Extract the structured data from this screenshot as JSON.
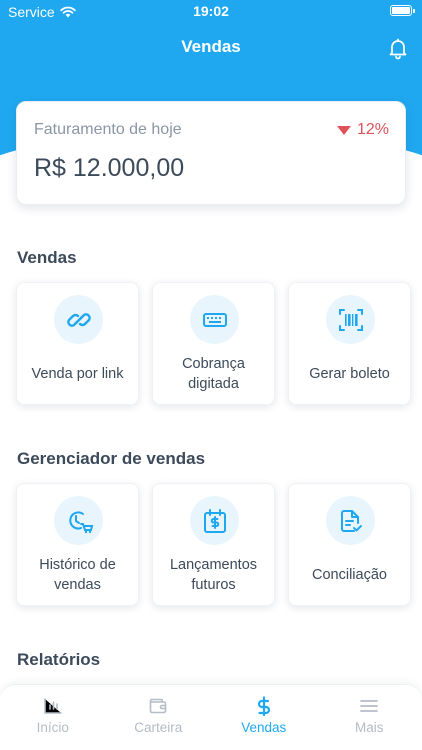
{
  "status_bar": {
    "carrier": "Service",
    "time": "19:02"
  },
  "header": {
    "title": "Vendas"
  },
  "revenue_card": {
    "label": "Faturamento de hoje",
    "change": "12%",
    "value": "R$ 12.000,00"
  },
  "sections": {
    "vendas": {
      "title": "Vendas",
      "tiles": [
        {
          "label": "Venda por link",
          "icon": "link-icon"
        },
        {
          "label": "Cobrança\ndigitada",
          "icon": "keyboard-icon"
        },
        {
          "label": "Gerar boleto",
          "icon": "barcode-icon"
        }
      ]
    },
    "gerenciador": {
      "title": "Gerenciador de vendas",
      "tiles": [
        {
          "label": "Histórico de\nvendas",
          "icon": "sales-history-icon"
        },
        {
          "label": "Lançamentos\nfuturos",
          "icon": "calendar-dollar-icon"
        },
        {
          "label": "Conciliação",
          "icon": "document-check-icon"
        }
      ]
    },
    "relatorios": {
      "title": "Relatórios"
    }
  },
  "tabs": [
    {
      "label": "Início",
      "icon": "bar-chart-icon",
      "active": false
    },
    {
      "label": "Carteira",
      "icon": "wallet-icon",
      "active": false
    },
    {
      "label": "Vendas",
      "icon": "dollar-icon",
      "active": true
    },
    {
      "label": "Mais",
      "icon": "menu-icon",
      "active": false
    }
  ],
  "colors": {
    "primary": "#1fa8f0",
    "negative": "#e0525b",
    "text": "#3c4a5a",
    "muted": "#8a96a6",
    "tab_inactive": "#b4bcc6"
  }
}
